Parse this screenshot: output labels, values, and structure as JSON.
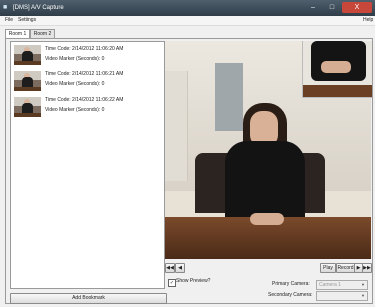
{
  "window": {
    "title": "[DMS] A/V Capture",
    "close_label": "X"
  },
  "menu": {
    "file": "File",
    "settings": "Settings",
    "help": "Help"
  },
  "tabs": [
    {
      "label": "Room 1",
      "active": true
    },
    {
      "label": "Room 2",
      "active": false
    }
  ],
  "bookmarks": [
    {
      "time_code": "Time Code: 2/14/2012 11:06:20 AM",
      "video_marker": "Video Marker (Seconds): 0"
    },
    {
      "time_code": "Time Code: 2/14/2012 11:06:21 AM",
      "video_marker": "Video Marker (Seconds): 0"
    },
    {
      "time_code": "Time Code: 2/14/2012 11:06:22 AM",
      "video_marker": "Video Marker (Seconds): 0"
    }
  ],
  "add_bookmark_label": "Add Bookmark",
  "controls": {
    "play": "Play",
    "record": "Record",
    "show_preview": "Show Preview?",
    "show_preview_checked": true,
    "primary_camera_label": "Primary Camera:",
    "primary_camera_value": "Camera 1",
    "secondary_camera_label": "Secondary Camera:",
    "secondary_camera_value": ""
  }
}
